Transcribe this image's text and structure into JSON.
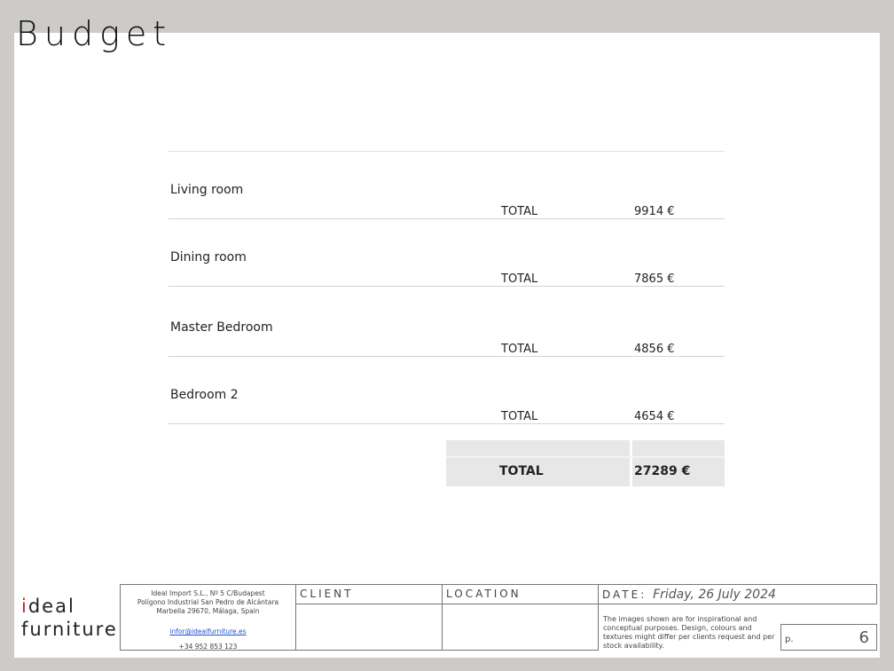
{
  "page_title": "Budget",
  "rooms": [
    {
      "name": "Living room",
      "total_label": "TOTAL",
      "total": "9914 €"
    },
    {
      "name": "Dining room",
      "total_label": "TOTAL",
      "total": "7865 €"
    },
    {
      "name": "Master Bedroom",
      "total_label": "TOTAL",
      "total": "4856 €"
    },
    {
      "name": "Bedroom 2",
      "total_label": "TOTAL",
      "total": "4654 €"
    }
  ],
  "grand_total": {
    "label": "TOTAL",
    "value": "27289 €"
  },
  "logo": {
    "line1_dot": "i",
    "line1_rest": "deal",
    "line2": "furniture",
    "accent_color": "#d0202a"
  },
  "footer": {
    "company_line1": "Ideal Import S.L., Nº 5 C/Budapest",
    "company_line2": "Polígono Industrial San Pedro de Alcántara",
    "company_line3": "Marbella 29670, Málaga, Spain",
    "email": "infor@idealfurniture.es",
    "phone": "+34 952 853 123",
    "client_label": "CLIENT",
    "location_label": "LOCATION",
    "date_label": "DATE:",
    "date_value": "Friday, 26 July 2024",
    "disclaimer": "The images shown are for inspirational and conceptual purposes. Design, colours and textures might differ per clients request and per stock availability.",
    "page_label": "p.",
    "page_number": "6"
  }
}
